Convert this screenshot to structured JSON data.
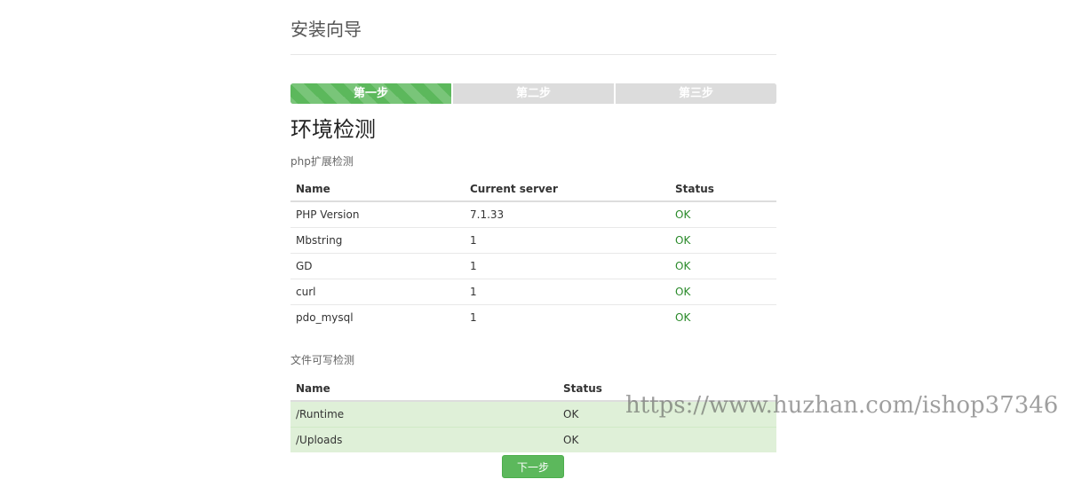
{
  "header": {
    "title": "安装向导"
  },
  "steps": [
    {
      "label": "第一步",
      "active": true
    },
    {
      "label": "第二步",
      "active": false
    },
    {
      "label": "第三步",
      "active": false
    }
  ],
  "section": {
    "title": "环境检测"
  },
  "php_extensions": {
    "title": "php扩展检测",
    "columns": [
      "Name",
      "Current server",
      "Status"
    ],
    "rows": [
      [
        "PHP Version",
        "7.1.33",
        "OK"
      ],
      [
        "Mbstring",
        "1",
        "OK"
      ],
      [
        "GD",
        "1",
        "OK"
      ],
      [
        "curl",
        "1",
        "OK"
      ],
      [
        "pdo_mysql",
        "1",
        "OK"
      ]
    ]
  },
  "writable": {
    "title": "文件可写检测",
    "columns": [
      "Name",
      "Status"
    ],
    "rows": [
      [
        "/Runtime",
        "OK"
      ],
      [
        "/Uploads",
        "OK"
      ]
    ]
  },
  "actions": {
    "next_label": "下一步"
  },
  "watermark": "https://www.huzhan.com/ishop37346",
  "colors": {
    "accent": "#5cb85c",
    "ok_text": "#2a8a2a",
    "row_success": "#dff0d8",
    "step_inactive": "#dcdcdc"
  }
}
